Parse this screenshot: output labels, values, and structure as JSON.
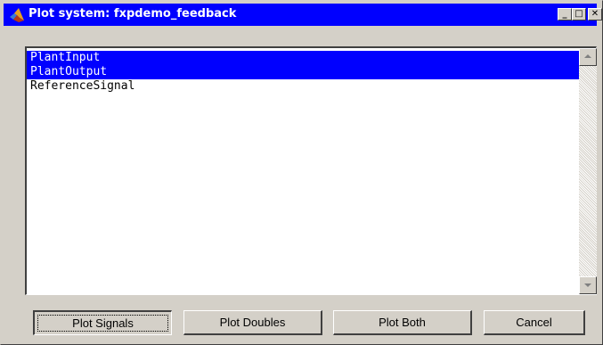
{
  "window": {
    "title": "Plot system: fxpdemo_feedback",
    "titlebar_color": "#0000ff",
    "minimize_glyph": "_",
    "maximize_glyph": "□",
    "close_glyph": "✕"
  },
  "signal_list": {
    "items": [
      {
        "label": "PlantInput",
        "selected": true
      },
      {
        "label": "PlantOutput",
        "selected": true
      },
      {
        "label": "ReferenceSignal",
        "selected": false
      }
    ],
    "selection_color": "#0000ff"
  },
  "buttons": {
    "plot_signals": "Plot Signals",
    "plot_doubles": "Plot Doubles",
    "plot_both": "Plot Both",
    "cancel": "Cancel"
  },
  "icons": {
    "app": "matlab-logo-icon",
    "minimize": "minimize-icon",
    "maximize": "maximize-icon",
    "close": "close-icon",
    "scroll_up": "scroll-up-arrow-icon",
    "scroll_down": "scroll-down-arrow-icon"
  }
}
